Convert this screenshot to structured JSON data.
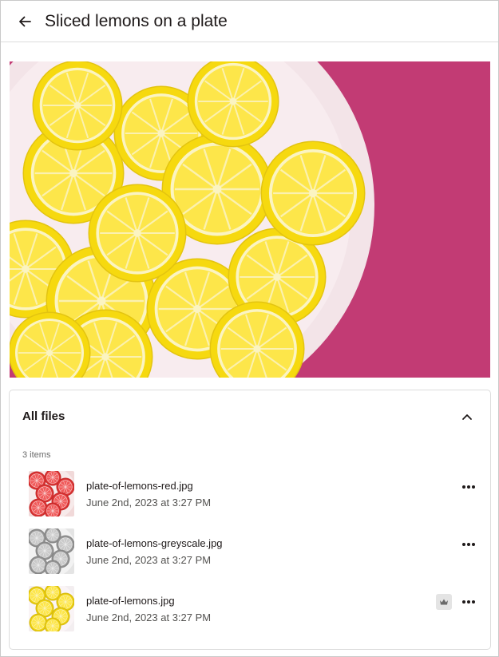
{
  "header": {
    "back_icon": "arrow-left-icon",
    "title": "Sliced lemons on a plate"
  },
  "preview": {
    "subject": "lemon-slices-plate-image",
    "colors": {
      "background": "#c23b74",
      "plate": "#f7e9ec",
      "lemon_rind": "#f6d90f",
      "lemon_flesh": "#fde64a"
    }
  },
  "files_panel": {
    "title": "All files",
    "collapse_icon": "chevron-up-icon",
    "count_label": "3 items",
    "items": [
      {
        "name": "plate-of-lemons-red.jpg",
        "date": "June 2nd, 2023 at 3:27 PM",
        "variant": "red",
        "premium": false,
        "more_icon": "more-horizontal-icon"
      },
      {
        "name": "plate-of-lemons-greyscale.jpg",
        "date": "June 2nd, 2023 at 3:27 PM",
        "variant": "greyscale",
        "premium": false,
        "more_icon": "more-horizontal-icon"
      },
      {
        "name": "plate-of-lemons.jpg",
        "date": "June 2nd, 2023 at 3:27 PM",
        "variant": "original",
        "premium": true,
        "premium_icon": "crown-icon",
        "more_icon": "more-horizontal-icon"
      }
    ]
  }
}
